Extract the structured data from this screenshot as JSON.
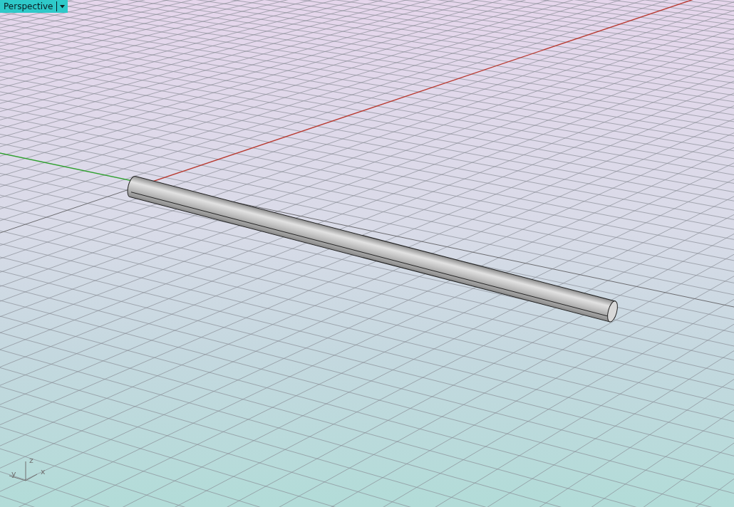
{
  "viewport": {
    "title": "Perspective"
  },
  "axis_widget": {
    "labels": [
      "z",
      "y",
      "x"
    ]
  }
}
